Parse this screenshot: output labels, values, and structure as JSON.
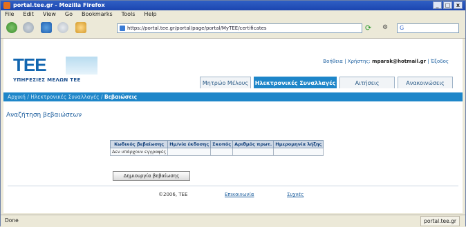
{
  "window": {
    "title": "portal.tee.gr - Mozilla Firefox",
    "ctrl_min": "_",
    "ctrl_max": "□",
    "ctrl_close": "x"
  },
  "menu": [
    "File",
    "Edit",
    "View",
    "Go",
    "Bookmarks",
    "Tools",
    "Help"
  ],
  "browser": {
    "url": "https://portal.tee.gr/portal/page/portal/MyTEE/certificates",
    "search_placeholder": "G",
    "go_label": "⟳",
    "status_left": "Done",
    "status_right": "portal.tee.gr"
  },
  "site": {
    "logo": "ΤΕΕ",
    "logo_sub": "ΥΠΗΡΕΣΙΕΣ ΜΕΛΩΝ ΤΕΕ",
    "user_help": "Βοήθεια",
    "user_prefix": "Χρήστης:",
    "user_email": "mparak@hotmail.gr",
    "user_logout": "Έξοδος",
    "tabs": [
      "Μητρώο Μέλους",
      "Ηλεκτρονικές Συναλλαγές",
      "Αιτήσεις",
      "Ανακοινώσεις"
    ],
    "active_tab": 1,
    "breadcrumb_path": "Αρχική / Ηλεκτρονικές Συναλλαγές",
    "breadcrumb_current": "Βεβαιώσεις",
    "heading": "Αναζήτηση βεβαιώσεων",
    "table": {
      "headers": [
        "Κωδικός βεβαίωσης",
        "Ημ/νία έκδοσης",
        "Σκοπός",
        "Αριθμός πρωτ.",
        "Ημερομηνία λήξης"
      ],
      "empty_text": "Δεν υπάρχουν εγγραφές"
    },
    "create_button": "Δημιουργία βεβαίωσης",
    "footer": [
      "©2006, ΤΕΕ",
      "Επικοινωνία",
      "Συχνές"
    ]
  },
  "colors": {
    "accent": "#1e86c9",
    "logo": "#1266b0"
  }
}
